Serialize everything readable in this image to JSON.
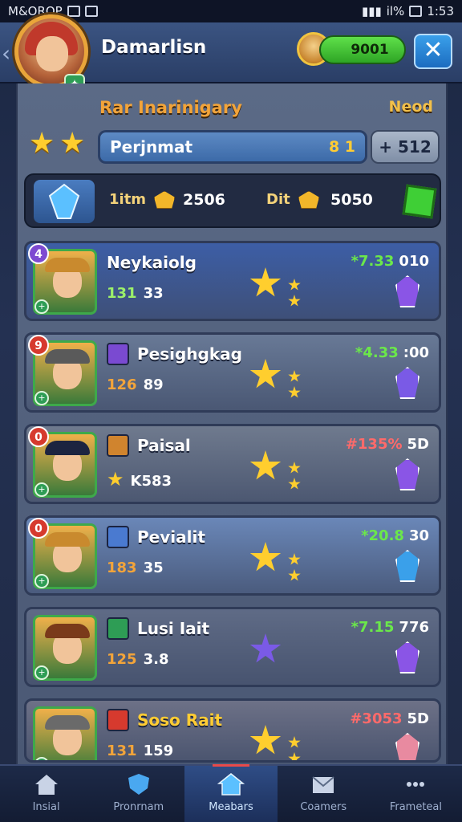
{
  "status_bar": {
    "carrier": "M&OROP",
    "battery_text": "il%",
    "time": "1:53"
  },
  "header": {
    "player_name": "Damarlisn",
    "coins": "9001",
    "close_label": "✕"
  },
  "panel": {
    "title": "Rar Inarinigary",
    "right_label": "Neod",
    "field_name": "Perjnmat",
    "field_value": "8 1",
    "plus_value": "+ 512",
    "resources": [
      {
        "label": "1itm",
        "value": "2506"
      },
      {
        "label": "Dit",
        "value": "5050"
      }
    ]
  },
  "cards": [
    {
      "rank": "4",
      "name": "Neykaiolg",
      "level_label": "131",
      "level_value": "33",
      "delta": "*7.33",
      "rest": "010",
      "bg": "#3d5ea6",
      "rank_bg": "#7d4ad1",
      "crystal": "#8a55e6",
      "delta_color": "#6be84a"
    },
    {
      "rank": "9",
      "name": "Pesighgkag",
      "level_label": "126",
      "level_value": "89",
      "delta": "*4.33",
      "rest": ":00",
      "bg": "#687996",
      "rank_bg": "#d63a2e",
      "crystal": "#7a5ae6",
      "delta_color": "#6be84a"
    },
    {
      "rank": "0",
      "name": "Paisal",
      "level_label": "",
      "level_value": "K583",
      "delta": "#135%",
      "rest": "5D",
      "bg": "#6f7a8e",
      "rank_bg": "#d63a2e",
      "crystal": "#8a55e6",
      "delta_color": "#ff6a6a"
    },
    {
      "rank": "0",
      "name": "Pevialit",
      "level_label": "183",
      "level_value": "35",
      "delta": "*20.8",
      "rest": "30",
      "bg": "#6a87b8",
      "rank_bg": "#d63a2e",
      "crystal": "#3aa0ea",
      "delta_color": "#6be84a"
    },
    {
      "rank": "",
      "name": "Lusi Iait",
      "level_label": "125",
      "level_value": "3.8",
      "delta": "*7.15",
      "rest": "776",
      "bg": "#5f6b86",
      "rank_bg": "#2e64c0",
      "crystal": "#8a55e6",
      "delta_color": "#6be84a"
    },
    {
      "rank": "",
      "name": "Soso Rait",
      "level_label": "131",
      "level_value": "159",
      "delta": "#3053",
      "rest": "5D",
      "bg": "#6d7187",
      "rank_bg": "#2e64c0",
      "crystal": "#e88aa0",
      "delta_color": "#ff6a6a"
    }
  ],
  "nav": [
    {
      "label": "Insial",
      "icon": "home-icon"
    },
    {
      "label": "Pronrnam",
      "icon": "shield-icon"
    },
    {
      "label": "Meabars",
      "icon": "house-badge-icon",
      "active": true
    },
    {
      "label": "Coamers",
      "icon": "envelope-icon"
    },
    {
      "label": "Frameteal",
      "icon": "dots-icon"
    }
  ]
}
